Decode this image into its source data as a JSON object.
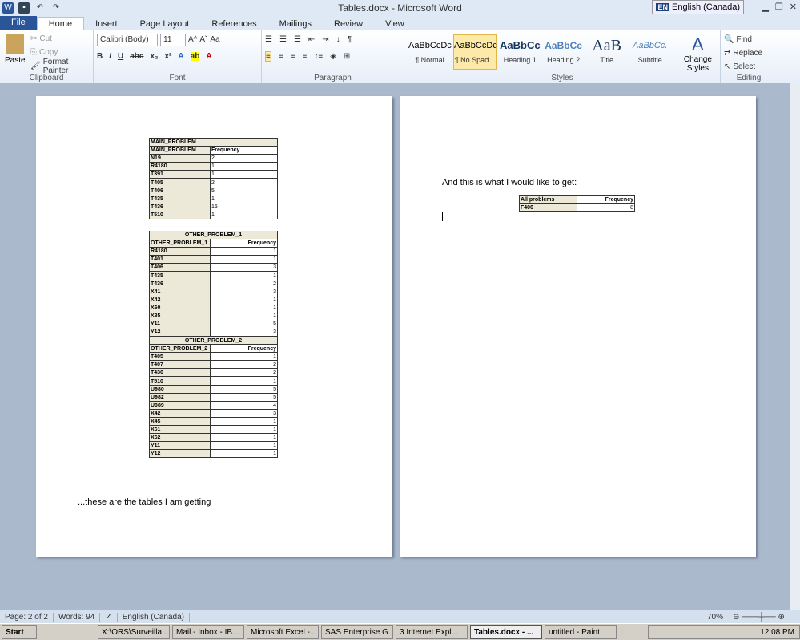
{
  "window": {
    "title": "Tables.docx - Microsoft Word",
    "language": "English (Canada)",
    "lang_code": "EN"
  },
  "tabs": [
    "File",
    "Home",
    "Insert",
    "Page Layout",
    "References",
    "Mailings",
    "Review",
    "View"
  ],
  "ribbon": {
    "clipboard": {
      "label": "Clipboard",
      "paste": "Paste",
      "cut": "Cut",
      "copy": "Copy",
      "format_painter": "Format Painter"
    },
    "font": {
      "label": "Font",
      "name": "Calibri (Body)",
      "size": "11"
    },
    "paragraph": {
      "label": "Paragraph"
    },
    "styles": {
      "label": "Styles",
      "items": [
        {
          "preview": "AaBbCcDc",
          "name": "¶ Normal"
        },
        {
          "preview": "AaBbCcDc",
          "name": "¶ No Spaci..."
        },
        {
          "preview": "AaBbCc",
          "name": "Heading 1"
        },
        {
          "preview": "AaBbCc",
          "name": "Heading 2"
        },
        {
          "preview": "AaB",
          "name": "Title"
        },
        {
          "preview": "AaBbCc.",
          "name": "Subtitle"
        }
      ],
      "change_styles": "Change Styles"
    },
    "editing": {
      "label": "Editing",
      "find": "Find",
      "replace": "Replace",
      "select": "Select"
    }
  },
  "page1": {
    "t1": {
      "title": "MAIN_PROBLEM",
      "col1": "MAIN_PROBLEM",
      "col2": "Frequency",
      "rows": [
        [
          "N19",
          "2"
        ],
        [
          "R4180",
          "1"
        ],
        [
          "T391",
          "1"
        ],
        [
          "T405",
          "2"
        ],
        [
          "T406",
          "5"
        ],
        [
          "T435",
          "1"
        ],
        [
          "T436",
          "15"
        ],
        [
          "T510",
          "1"
        ]
      ]
    },
    "t2": {
      "title": "OTHER_PROBLEM_1",
      "col1": "OTHER_PROBLEM_1",
      "col2": "Frequency",
      "rows": [
        [
          "R4180",
          "1"
        ],
        [
          "T401",
          "1"
        ],
        [
          "T406",
          "3"
        ],
        [
          "T435",
          "1"
        ],
        [
          "T436",
          "2"
        ],
        [
          "X41",
          "3"
        ],
        [
          "X42",
          "1"
        ],
        [
          "X60",
          "1"
        ],
        [
          "X85",
          "1"
        ],
        [
          "Y11",
          "5"
        ],
        [
          "Y12",
          "3"
        ]
      ]
    },
    "t3": {
      "title": "OTHER_PROBLEM_2",
      "col1": "OTHER_PROBLEM_2",
      "col2": "Frequency",
      "rows": [
        [
          "T405",
          "1"
        ],
        [
          "T407",
          "2"
        ],
        [
          "T436",
          "2"
        ],
        [
          "T510",
          "1"
        ],
        [
          "U980",
          "5"
        ],
        [
          "U982",
          "5"
        ],
        [
          "U989",
          "4"
        ],
        [
          "X42",
          "3"
        ],
        [
          "X45",
          "1"
        ],
        [
          "X61",
          "1"
        ],
        [
          "X62",
          "1"
        ],
        [
          "Y11",
          "1"
        ],
        [
          "Y12",
          "1"
        ]
      ]
    },
    "caption": "...these are the tables I am getting"
  },
  "page2": {
    "text": "And this is what I would like to get:",
    "table": {
      "col1": "All problems",
      "col2": "Frequency",
      "rows": [
        [
          "F406",
          "8"
        ]
      ]
    }
  },
  "status": {
    "page": "Page: 2 of 2",
    "words": "Words: 94",
    "language": "English (Canada)",
    "zoom": "70%"
  },
  "taskbar": {
    "start": "Start",
    "items": [
      "X:\\ORS\\Surveilla...",
      "Mail - Inbox - IB...",
      "Microsoft Excel -...",
      "SAS Enterprise G...",
      "3 Internet Expl...",
      "Tables.docx - ...",
      "untitled - Paint"
    ],
    "clock": "12:08 PM"
  }
}
